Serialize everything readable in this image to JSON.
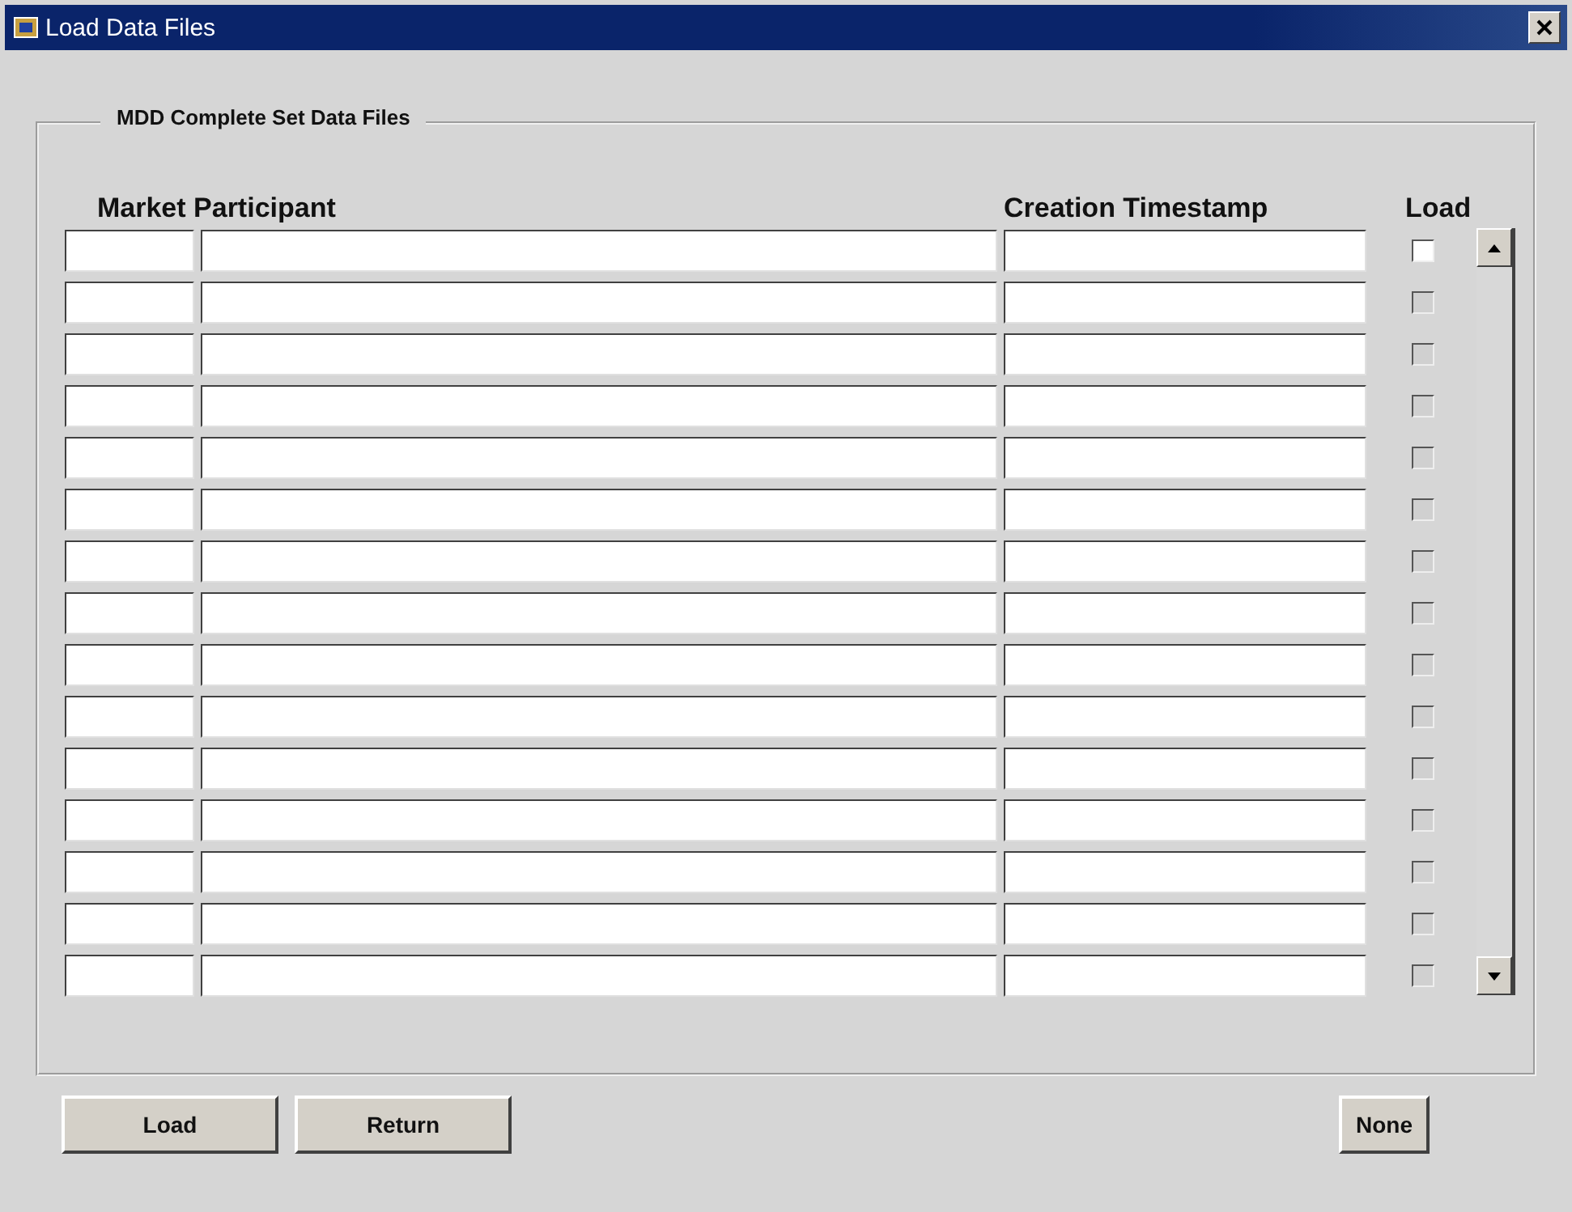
{
  "window": {
    "title": "Load Data Files"
  },
  "group": {
    "title": "MDD Complete Set Data Files"
  },
  "table": {
    "columns": [
      "Market Participant",
      "Creation Timestamp",
      "Load"
    ],
    "rows": [
      {
        "checked": false,
        "disabled": false
      },
      {
        "checked": false,
        "disabled": true
      },
      {
        "checked": false,
        "disabled": true
      },
      {
        "checked": false,
        "disabled": true
      },
      {
        "checked": false,
        "disabled": true
      },
      {
        "checked": false,
        "disabled": true
      },
      {
        "checked": false,
        "disabled": true
      },
      {
        "checked": false,
        "disabled": true
      },
      {
        "checked": false,
        "disabled": true
      },
      {
        "checked": false,
        "disabled": true
      },
      {
        "checked": false,
        "disabled": true
      },
      {
        "checked": false,
        "disabled": true
      },
      {
        "checked": false,
        "disabled": true
      },
      {
        "checked": false,
        "disabled": true
      },
      {
        "checked": false,
        "disabled": true
      }
    ]
  },
  "buttons": {
    "left": [
      "Load",
      "Return"
    ],
    "right": [
      "None"
    ]
  }
}
